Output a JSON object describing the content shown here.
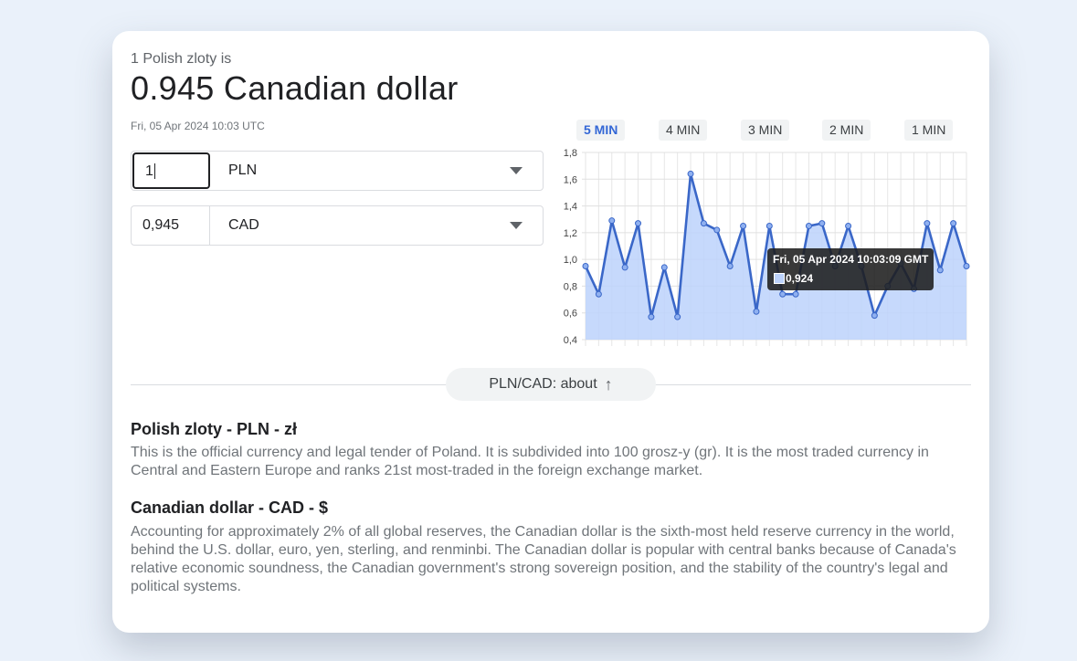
{
  "header": {
    "subtitle": "1 Polish zloty is",
    "result": "0.945 Canadian dollar",
    "timestamp": "Fri, 05 Apr 2024 10:03 UTC"
  },
  "converter": {
    "from": {
      "amount": "1",
      "currency": "PLN"
    },
    "to": {
      "amount": "0,945",
      "currency": "CAD"
    }
  },
  "ranges": [
    "5 MIN",
    "4 MIN",
    "3 MIN",
    "2 MIN",
    "1 MIN"
  ],
  "selected_range": "5 MIN",
  "tooltip": {
    "title": "Fri, 05 Apr 2024 10:03:09 GMT",
    "value": "0,924"
  },
  "about_button": "PLN/CAD: about",
  "sections": [
    {
      "heading": "Polish zloty - PLN - zł",
      "text": "This is the official currency and legal tender of Poland. It is subdivided into 100 grosz-y (gr). It is the most traded currency in Central and Eastern Europe and ranks 21st most-traded in the foreign exchange market."
    },
    {
      "heading": "Canadian dollar - CAD - $",
      "text": "Accounting for approximately 2% of all global reserves, the Canadian dollar is the sixth-most held reserve currency in the world, behind the U.S. dollar, euro, yen, sterling, and renminbi. The Canadian dollar is popular with central banks because of Canada's relative economic soundness, the Canadian government's strong sovereign position, and the stability of the country's legal and political systems."
    }
  ],
  "colors": {
    "line": "#3a67c8",
    "fill": "#bcd2fb",
    "accent": "#3367d6"
  },
  "chart_data": {
    "type": "area",
    "ylim": [
      0.4,
      1.8
    ],
    "yticks": [
      "0,4",
      "0,6",
      "0,8",
      "1,0",
      "1,2",
      "1,4",
      "1,6",
      "1,8"
    ],
    "grid": true,
    "values": [
      0.95,
      0.74,
      1.29,
      0.94,
      1.27,
      0.57,
      0.94,
      0.57,
      1.64,
      1.27,
      1.22,
      0.95,
      1.25,
      0.61,
      1.25,
      0.74,
      0.74,
      1.25,
      1.27,
      0.95,
      1.25,
      0.95,
      0.58,
      0.8,
      0.97,
      0.78,
      1.27,
      0.92,
      1.27,
      0.95
    ]
  }
}
